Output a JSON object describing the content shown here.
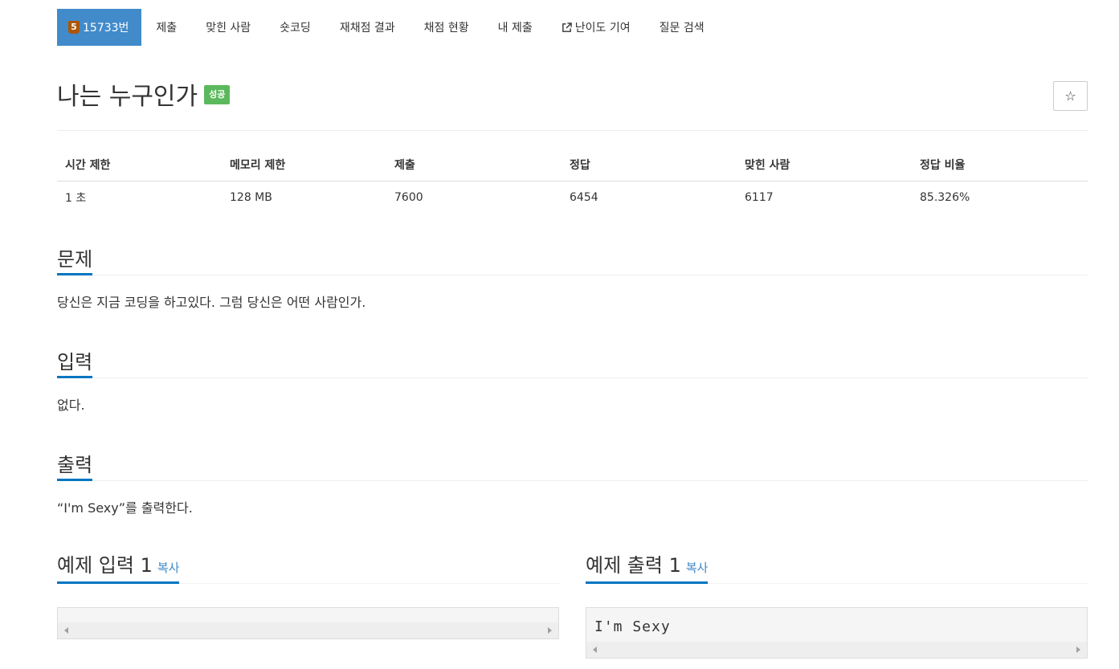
{
  "nav": {
    "active": {
      "badge": "5",
      "label": "15733번"
    },
    "items": [
      "제출",
      "맞힌 사람",
      "숏코딩",
      "재채점 결과",
      "채점 현황",
      "내 제출",
      "난이도 기여",
      "질문 검색"
    ]
  },
  "problem": {
    "title": "나는 누구인가",
    "status": "성공",
    "star": "☆"
  },
  "info": {
    "headers": [
      "시간 제한",
      "메모리 제한",
      "제출",
      "정답",
      "맞힌 사람",
      "정답 비율"
    ],
    "values": [
      "1 초",
      "128 MB",
      "7600",
      "6454",
      "6117",
      "85.326%"
    ]
  },
  "sections": {
    "description": {
      "title": "문제",
      "body": "당신은 지금 코딩을 하고있다. 그럼 당신은 어떤 사람인가."
    },
    "input": {
      "title": "입력",
      "body": "없다."
    },
    "output": {
      "title": "출력",
      "body": "“I'm Sexy”를 출력한다."
    }
  },
  "samples": {
    "input": {
      "title": "예제 입력 1",
      "copy": "복사",
      "content": ""
    },
    "output": {
      "title": "예제 출력 1",
      "copy": "복사",
      "content": "I'm Sexy"
    }
  },
  "colors": {
    "accent": "#428bca",
    "underline": "#0076c0",
    "success": "#5cb85c",
    "tier": "#ad5600"
  }
}
